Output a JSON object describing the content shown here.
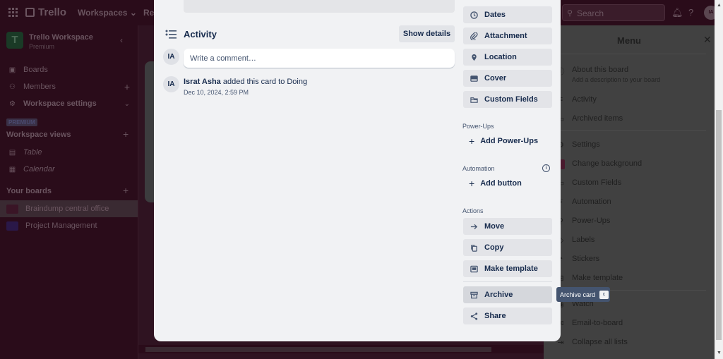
{
  "topbar": {
    "app_name": "Trello",
    "workspaces_label": "Workspaces",
    "recent_label": "Rec",
    "search_placeholder": "Search",
    "avatar_initials": "IA"
  },
  "sidebar": {
    "workspace_initial": "T",
    "workspace_name": "Trello Workspace",
    "workspace_plan": "Premium",
    "items": [
      {
        "label": "Boards",
        "icon": "board-icon"
      },
      {
        "label": "Members",
        "icon": "person-icon"
      },
      {
        "label": "Workspace settings",
        "icon": "gear-icon"
      }
    ],
    "premium_badge": "PREMIUM",
    "views_heading": "Workspace views",
    "views": [
      {
        "label": "Table",
        "icon": "table-icon"
      },
      {
        "label": "Calendar",
        "icon": "calendar-icon"
      }
    ],
    "boards_heading": "Your boards",
    "boards": [
      {
        "label": "Braindump central office",
        "color": "#3a1526"
      },
      {
        "label": "Project Management",
        "color": "#2a1848"
      }
    ]
  },
  "card": {
    "activity_title": "Activity",
    "show_details_label": "Show details",
    "comment_placeholder": "Write a comment…",
    "user_initials": "IA",
    "entries": [
      {
        "user": "Israt Asha",
        "action": "added this card to Doing",
        "time": "Dec 10, 2024, 2:59 PM"
      }
    ],
    "side_buttons": [
      {
        "label": "Dates",
        "icon": "clock-icon"
      },
      {
        "label": "Attachment",
        "icon": "paperclip-icon"
      },
      {
        "label": "Location",
        "icon": "location-pin-icon"
      },
      {
        "label": "Cover",
        "icon": "cover-icon"
      },
      {
        "label": "Custom Fields",
        "icon": "custom-fields-icon"
      }
    ],
    "powerups_heading": "Power-Ups",
    "add_powerups_label": "Add Power-Ups",
    "automation_heading": "Automation",
    "add_button_label": "Add button",
    "actions_heading": "Actions",
    "actions": [
      {
        "label": "Move",
        "icon": "arrow-right-icon"
      },
      {
        "label": "Copy",
        "icon": "copy-icon"
      },
      {
        "label": "Make template",
        "icon": "template-icon"
      },
      {
        "label": "Archive",
        "icon": "archive-icon"
      },
      {
        "label": "Share",
        "icon": "share-icon"
      }
    ]
  },
  "tooltip": {
    "label": "Archive card",
    "shortcut": "c"
  },
  "menu": {
    "title": "Menu",
    "items": [
      {
        "label": "About this board",
        "sub": "Add a description to your board",
        "icon": "info-icon"
      },
      {
        "label": "Activity",
        "icon": "activity-icon"
      },
      {
        "label": "Archived items",
        "icon": "archive-icon"
      },
      {
        "label": "Settings",
        "icon": "gear-icon"
      },
      {
        "label": "Change background",
        "icon": "background-swatch-icon"
      },
      {
        "label": "Custom Fields",
        "icon": "custom-fields-icon"
      },
      {
        "label": "Automation",
        "icon": "automation-icon"
      },
      {
        "label": "Power-Ups",
        "icon": "rocket-icon"
      },
      {
        "label": "Labels",
        "icon": "label-icon"
      },
      {
        "label": "Stickers",
        "icon": "sticker-icon"
      },
      {
        "label": "Make template",
        "icon": "template-icon"
      },
      {
        "label": "Watch",
        "icon": "eye-icon"
      },
      {
        "label": "Email-to-board",
        "icon": "email-icon"
      },
      {
        "label": "Collapse all lists",
        "icon": "collapse-icon"
      }
    ]
  }
}
